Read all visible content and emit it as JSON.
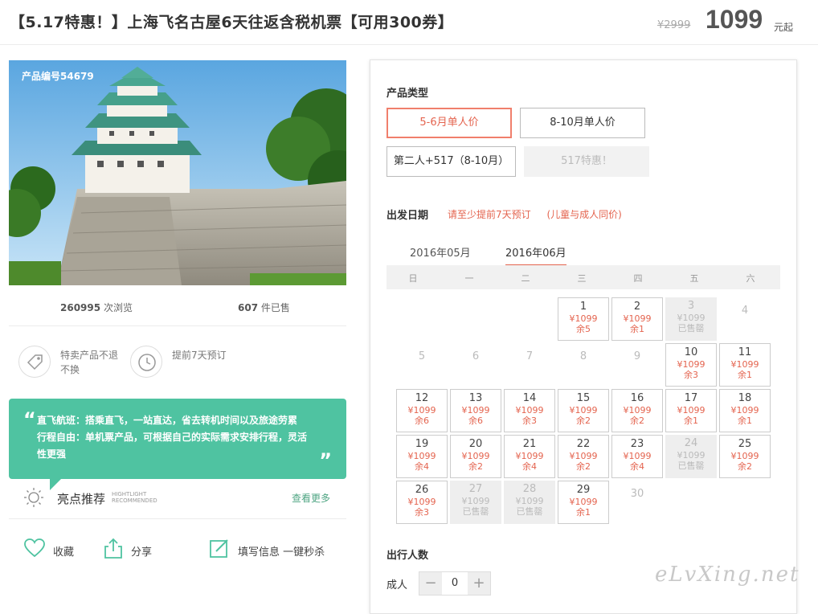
{
  "header": {
    "title": "【5.17特惠！】上海飞名古屋6天往返含税机票【可用300券】",
    "original_price": "¥2999",
    "price": "1099",
    "price_unit": "元起"
  },
  "product": {
    "number_label": "产品编号54679",
    "views_count": "260995",
    "views_label": "次浏览",
    "sold_count": "607",
    "sold_label": "件已售"
  },
  "features": [
    {
      "icon": "tag-icon",
      "text": "特卖产品不退不换"
    },
    {
      "icon": "clock-icon",
      "text": "提前7天预订"
    }
  ],
  "highlight_bubble": {
    "line1": "直飞航班：搭乘直飞，一站直达，省去转机时间以及旅途劳累",
    "line2": "行程自由：单机票产品，可根据自己的实际需求安排行程，灵活性更强"
  },
  "highlights": {
    "title": "亮点推荐",
    "en_line1": "HIGHTLIGHT",
    "en_line2": "RECOMMENDED",
    "more": "查看更多"
  },
  "actions": {
    "favorite": "收藏",
    "share": "分享",
    "fill_info": "填写信息 一键秒杀"
  },
  "booking": {
    "type_title": "产品类型",
    "types": [
      {
        "label": "5-6月单人价",
        "state": "active"
      },
      {
        "label": "8-10月单人价",
        "state": "normal"
      },
      {
        "label": "第二人+517（8-10月）",
        "state": "normal"
      },
      {
        "label": "517特惠！",
        "state": "disabled"
      }
    ],
    "date_title": "出发日期",
    "note1": "请至少提前7天预订",
    "note2": "(儿童与成人同价)",
    "months": [
      "2016年05月",
      "2016年06月"
    ],
    "active_month": "2016年06月",
    "weekdays": [
      "日",
      "一",
      "二",
      "三",
      "四",
      "五",
      "六"
    ],
    "days": [
      {
        "d": "1",
        "p": "¥1099",
        "s": "余5",
        "st": "avail"
      },
      {
        "d": "2",
        "p": "¥1099",
        "s": "余1",
        "st": "avail"
      },
      {
        "d": "3",
        "p": "¥1099",
        "s": "已售罄",
        "st": "sold"
      },
      {
        "d": "4",
        "st": "plain"
      },
      {
        "d": "5",
        "st": "plain"
      },
      {
        "d": "6",
        "st": "plain"
      },
      {
        "d": "7",
        "st": "plain"
      },
      {
        "d": "8",
        "st": "plain"
      },
      {
        "d": "9",
        "st": "plain"
      },
      {
        "d": "10",
        "p": "¥1099",
        "s": "余3",
        "st": "avail"
      },
      {
        "d": "11",
        "p": "¥1099",
        "s": "余1",
        "st": "avail"
      },
      {
        "d": "12",
        "p": "¥1099",
        "s": "余6",
        "st": "avail"
      },
      {
        "d": "13",
        "p": "¥1099",
        "s": "余6",
        "st": "avail"
      },
      {
        "d": "14",
        "p": "¥1099",
        "s": "余3",
        "st": "avail"
      },
      {
        "d": "15",
        "p": "¥1099",
        "s": "余2",
        "st": "avail"
      },
      {
        "d": "16",
        "p": "¥1099",
        "s": "余2",
        "st": "avail"
      },
      {
        "d": "17",
        "p": "¥1099",
        "s": "余1",
        "st": "avail"
      },
      {
        "d": "18",
        "p": "¥1099",
        "s": "余1",
        "st": "avail"
      },
      {
        "d": "19",
        "p": "¥1099",
        "s": "余4",
        "st": "avail"
      },
      {
        "d": "20",
        "p": "¥1099",
        "s": "余2",
        "st": "avail"
      },
      {
        "d": "21",
        "p": "¥1099",
        "s": "余4",
        "st": "avail"
      },
      {
        "d": "22",
        "p": "¥1099",
        "s": "余2",
        "st": "avail"
      },
      {
        "d": "23",
        "p": "¥1099",
        "s": "余4",
        "st": "avail"
      },
      {
        "d": "24",
        "p": "¥1099",
        "s": "已售罄",
        "st": "sold"
      },
      {
        "d": "25",
        "p": "¥1099",
        "s": "余2",
        "st": "avail"
      },
      {
        "d": "26",
        "p": "¥1099",
        "s": "余3",
        "st": "avail"
      },
      {
        "d": "27",
        "p": "¥1099",
        "s": "已售罄",
        "st": "sold"
      },
      {
        "d": "28",
        "p": "¥1099",
        "s": "已售罄",
        "st": "sold"
      },
      {
        "d": "29",
        "p": "¥1099",
        "s": "余1",
        "st": "avail"
      },
      {
        "d": "30",
        "st": "plain"
      }
    ],
    "first_weekday": 3,
    "people_title": "出行人数",
    "adult_label": "成人",
    "adult_count": "0",
    "minus": "−",
    "plus": "+"
  },
  "watermark": "eLvXing.net",
  "colors": {
    "accent": "#e4644f",
    "green": "#4fc3a1"
  }
}
